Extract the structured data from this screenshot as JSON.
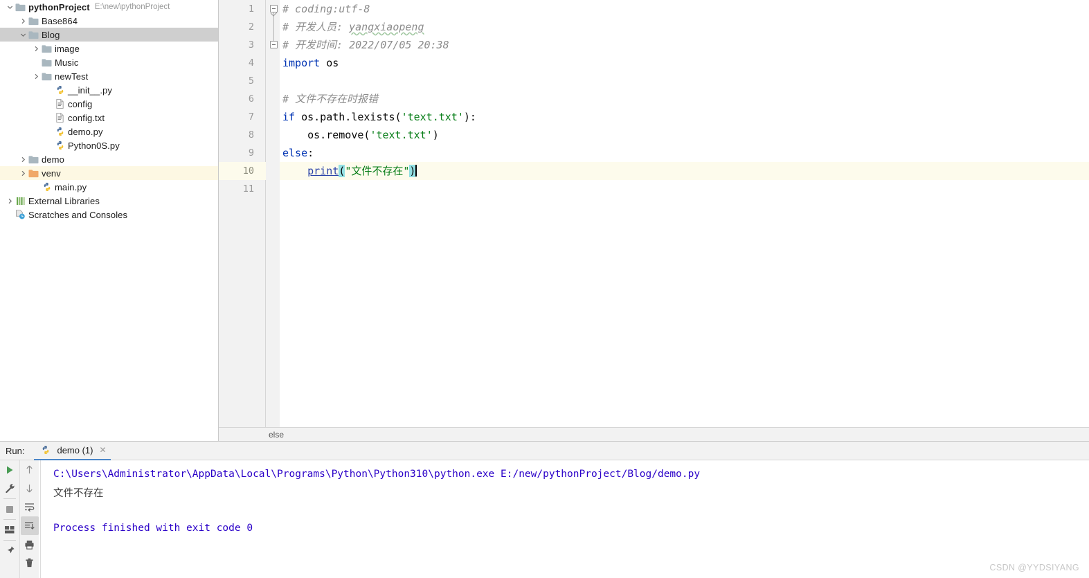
{
  "project_tree": {
    "items": [
      {
        "label": "pythonProject",
        "path": "E:\\new\\pythonProject",
        "icon": "folder-gray-icon",
        "indent": 0,
        "arrow": "down",
        "bold": true,
        "highlight": "none"
      },
      {
        "label": "Base864",
        "path": "",
        "icon": "folder-gray-icon",
        "indent": 1,
        "arrow": "right",
        "bold": false,
        "highlight": "none"
      },
      {
        "label": "Blog",
        "path": "",
        "icon": "folder-gray-icon",
        "indent": 1,
        "arrow": "down",
        "bold": false,
        "highlight": "gray"
      },
      {
        "label": "image",
        "path": "",
        "icon": "folder-gray-icon",
        "indent": 2,
        "arrow": "right",
        "bold": false,
        "highlight": "none"
      },
      {
        "label": "Music",
        "path": "",
        "icon": "folder-gray-icon",
        "indent": 2,
        "arrow": "none",
        "bold": false,
        "highlight": "none"
      },
      {
        "label": "newTest",
        "path": "",
        "icon": "folder-gray-icon",
        "indent": 2,
        "arrow": "right",
        "bold": false,
        "highlight": "none"
      },
      {
        "label": "__init__.py",
        "path": "",
        "icon": "python-file-icon",
        "indent": 3,
        "arrow": "none",
        "bold": false,
        "highlight": "none"
      },
      {
        "label": "config",
        "path": "",
        "icon": "text-file-icon",
        "indent": 3,
        "arrow": "none",
        "bold": false,
        "highlight": "none"
      },
      {
        "label": "config.txt",
        "path": "",
        "icon": "text-file-icon",
        "indent": 3,
        "arrow": "none",
        "bold": false,
        "highlight": "none"
      },
      {
        "label": "demo.py",
        "path": "",
        "icon": "python-file-icon",
        "indent": 3,
        "arrow": "none",
        "bold": false,
        "highlight": "none"
      },
      {
        "label": "Python0S.py",
        "path": "",
        "icon": "python-file-icon",
        "indent": 3,
        "arrow": "none",
        "bold": false,
        "highlight": "none"
      },
      {
        "label": "demo",
        "path": "",
        "icon": "folder-gray-icon",
        "indent": 1,
        "arrow": "right",
        "bold": false,
        "highlight": "none"
      },
      {
        "label": "venv",
        "path": "",
        "icon": "folder-orange-icon",
        "indent": 1,
        "arrow": "right",
        "bold": false,
        "highlight": "yellow"
      },
      {
        "label": "main.py",
        "path": "",
        "icon": "python-file-icon",
        "indent": 2,
        "arrow": "none",
        "bold": false,
        "highlight": "none"
      },
      {
        "label": "External Libraries",
        "path": "",
        "icon": "libraries-icon",
        "indent": 0,
        "arrow": "right",
        "bold": false,
        "highlight": "none"
      },
      {
        "label": "Scratches and Consoles",
        "path": "",
        "icon": "scratches-icon",
        "indent": 0,
        "arrow": "none",
        "bold": false,
        "highlight": "none"
      }
    ]
  },
  "editor": {
    "line_numbers": [
      "1",
      "2",
      "3",
      "4",
      "5",
      "6",
      "7",
      "8",
      "9",
      "10",
      "11"
    ],
    "current_line": 10,
    "code_lines": [
      {
        "n": 1,
        "segments": [
          {
            "t": "# coding:utf-8",
            "c": "cmt"
          }
        ]
      },
      {
        "n": 2,
        "segments": [
          {
            "t": "# 开发人员: ",
            "c": "cmt"
          },
          {
            "t": "yangxiaopeng",
            "c": "cmt squig"
          }
        ]
      },
      {
        "n": 3,
        "segments": [
          {
            "t": "# 开发时间: 2022/07/05 20:38",
            "c": "cmt"
          }
        ]
      },
      {
        "n": 4,
        "segments": [
          {
            "t": "import",
            "c": "kw"
          },
          {
            "t": " os",
            "c": "plain"
          }
        ]
      },
      {
        "n": 5,
        "segments": []
      },
      {
        "n": 6,
        "segments": [
          {
            "t": "# 文件不存在时报错",
            "c": "cmt"
          }
        ]
      },
      {
        "n": 7,
        "segments": [
          {
            "t": "if",
            "c": "kw"
          },
          {
            "t": " os.path.lexists(",
            "c": "plain"
          },
          {
            "t": "'text.txt'",
            "c": "str"
          },
          {
            "t": "):",
            "c": "plain"
          }
        ]
      },
      {
        "n": 8,
        "segments": [
          {
            "t": "    os.remove(",
            "c": "plain"
          },
          {
            "t": "'text.txt'",
            "c": "str"
          },
          {
            "t": ")",
            "c": "plain"
          }
        ]
      },
      {
        "n": 9,
        "segments": [
          {
            "t": "else",
            "c": "kw"
          },
          {
            "t": ":",
            "c": "plain"
          }
        ]
      },
      {
        "n": 10,
        "segments": [
          {
            "t": "    ",
            "c": "plain"
          },
          {
            "t": "print",
            "c": "fn-link"
          },
          {
            "t": "(",
            "c": "brace-hl"
          },
          {
            "t": "\"文件不存在\"",
            "c": "str"
          },
          {
            "t": ")",
            "c": "brace-hl"
          }
        ],
        "caret": true
      },
      {
        "n": 11,
        "segments": []
      }
    ],
    "fold_lines": [
      1,
      3
    ],
    "breadcrumb": "else"
  },
  "run_panel": {
    "label": "Run:",
    "tab": {
      "name": "demo (1)",
      "icon": "python-file-icon",
      "close": "✕"
    },
    "left_toolbar": [
      {
        "name": "rerun-button",
        "icon": "play-icon"
      },
      {
        "name": "settings-button",
        "icon": "wrench-icon"
      },
      {
        "name": "stop-button",
        "icon": "stop-icon"
      },
      {
        "name": "layout-button",
        "icon": "layout-icon"
      },
      {
        "name": "pin-button",
        "icon": "pin-icon"
      }
    ],
    "right_toolbar": [
      {
        "name": "prev-occurrence-button",
        "icon": "arrow-up-icon"
      },
      {
        "name": "next-occurrence-button",
        "icon": "arrow-down-icon"
      },
      {
        "name": "soft-wrap-button",
        "icon": "wrap-icon"
      },
      {
        "name": "scroll-to-end-button",
        "icon": "scroll-end-icon",
        "active": true
      },
      {
        "name": "print-button",
        "icon": "printer-icon"
      },
      {
        "name": "clear-all-button",
        "icon": "trash-icon"
      }
    ],
    "output": [
      {
        "text": "C:\\Users\\Administrator\\AppData\\Local\\Programs\\Python\\Python310\\python.exe E:/new/pythonProject/Blog/demo.py",
        "style": "cmd"
      },
      {
        "text": "文件不存在",
        "style": "res"
      },
      {
        "text": "",
        "style": "blank"
      },
      {
        "text": "Process finished with exit code 0",
        "style": "fin"
      }
    ]
  },
  "watermark": "CSDN @YYDSIYANG",
  "colors": {
    "keyword": "#0033b3",
    "string": "#067d17",
    "comment": "#8c8c8c",
    "console_blue": "#2a00c8",
    "brace_highlight": "#93e0e3",
    "selection_gray": "#cfcfcf",
    "current_line": "#fdfbec"
  }
}
